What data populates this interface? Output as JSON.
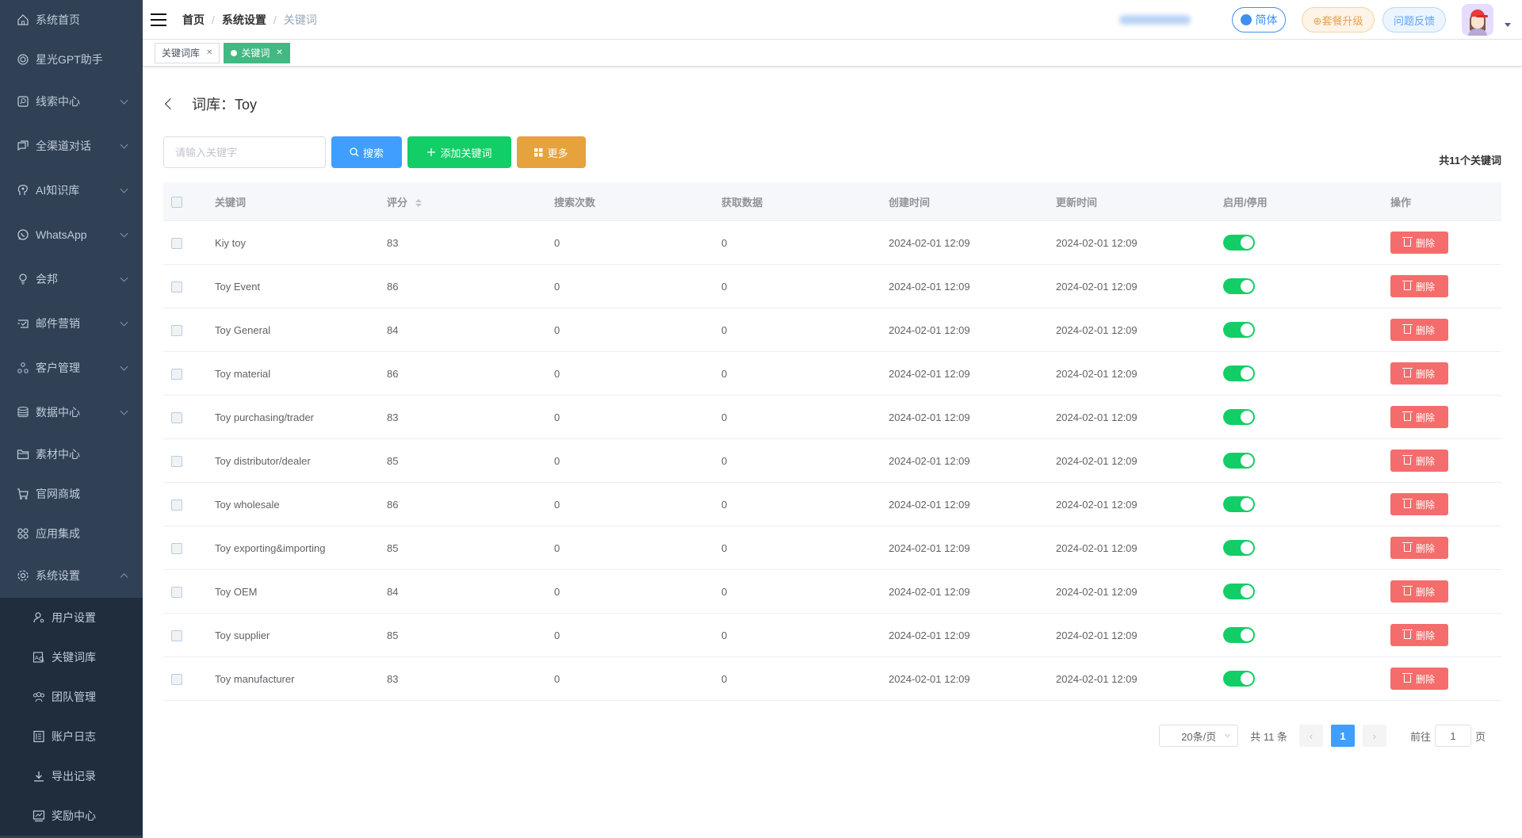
{
  "sidebar": {
    "items": [
      {
        "label": "系统首页",
        "icon": "home-icon",
        "expandable": false
      },
      {
        "label": "星光GPT助手",
        "icon": "gpt-icon",
        "expandable": false
      },
      {
        "label": "线索中心",
        "icon": "clue-search-icon",
        "expandable": true
      },
      {
        "label": "全渠道对话",
        "icon": "chat-bubbles-icon",
        "expandable": true
      },
      {
        "label": "AI知识库",
        "icon": "ai-brain-icon",
        "expandable": true
      },
      {
        "label": "WhatsApp",
        "icon": "whatsapp-icon",
        "expandable": true
      },
      {
        "label": "会邦",
        "icon": "lightbulb-icon",
        "expandable": true
      },
      {
        "label": "邮件营销",
        "icon": "mail-marketing-icon",
        "expandable": true
      },
      {
        "label": "客户管理",
        "icon": "customers-icon",
        "expandable": true
      },
      {
        "label": "数据中心",
        "icon": "database-icon",
        "expandable": true
      },
      {
        "label": "素材中心",
        "icon": "folder-icon",
        "expandable": false
      },
      {
        "label": "官网商城",
        "icon": "cart-icon",
        "expandable": false
      },
      {
        "label": "应用集成",
        "icon": "apps-icon",
        "expandable": false
      },
      {
        "label": "系统设置",
        "icon": "gear-icon",
        "expandable": true,
        "expanded": true
      }
    ],
    "submenu": [
      {
        "label": "用户设置",
        "icon": "user-settings-icon"
      },
      {
        "label": "关键词库",
        "icon": "keyword-search-icon"
      },
      {
        "label": "团队管理",
        "icon": "team-icon"
      },
      {
        "label": "账户日志",
        "icon": "log-icon"
      },
      {
        "label": "导出记录",
        "icon": "download-icon"
      },
      {
        "label": "奖励中心",
        "icon": "reward-chart-icon"
      }
    ]
  },
  "header": {
    "breadcrumb": [
      "首页",
      "系统设置",
      "关键词"
    ],
    "language_label": "简体",
    "upgrade_label": "⊕套餐升级",
    "feedback_label": "问题反馈"
  },
  "tags": [
    {
      "label": "关键词库",
      "active": false
    },
    {
      "label": "关键词",
      "active": true
    }
  ],
  "page": {
    "title": "词库：Toy",
    "search_placeholder": "请输入关键字",
    "search_value": "",
    "search_button": "搜索",
    "add_button": "添加关键词",
    "more_button": "更多",
    "total_keywords": "共11个关键词"
  },
  "table": {
    "columns": [
      "关键词",
      "评分",
      "搜索次数",
      "获取数据",
      "创建时间",
      "更新时间",
      "启用/停用",
      "操作"
    ],
    "delete_label": "删除",
    "rows": [
      {
        "keyword": "Kiy toy",
        "score": "83",
        "searches": "0",
        "fetched": "0",
        "created": "2024-02-01 12:09",
        "updated": "2024-02-01 12:09",
        "enabled": true
      },
      {
        "keyword": "Toy Event",
        "score": "86",
        "searches": "0",
        "fetched": "0",
        "created": "2024-02-01 12:09",
        "updated": "2024-02-01 12:09",
        "enabled": true
      },
      {
        "keyword": "Toy General",
        "score": "84",
        "searches": "0",
        "fetched": "0",
        "created": "2024-02-01 12:09",
        "updated": "2024-02-01 12:09",
        "enabled": true
      },
      {
        "keyword": "Toy material",
        "score": "86",
        "searches": "0",
        "fetched": "0",
        "created": "2024-02-01 12:09",
        "updated": "2024-02-01 12:09",
        "enabled": true
      },
      {
        "keyword": "Toy purchasing/trader",
        "score": "83",
        "searches": "0",
        "fetched": "0",
        "created": "2024-02-01 12:09",
        "updated": "2024-02-01 12:09",
        "enabled": true
      },
      {
        "keyword": "Toy distributor/dealer",
        "score": "85",
        "searches": "0",
        "fetched": "0",
        "created": "2024-02-01 12:09",
        "updated": "2024-02-01 12:09",
        "enabled": true
      },
      {
        "keyword": "Toy wholesale",
        "score": "86",
        "searches": "0",
        "fetched": "0",
        "created": "2024-02-01 12:09",
        "updated": "2024-02-01 12:09",
        "enabled": true
      },
      {
        "keyword": "Toy exporting&importing",
        "score": "85",
        "searches": "0",
        "fetched": "0",
        "created": "2024-02-01 12:09",
        "updated": "2024-02-01 12:09",
        "enabled": true
      },
      {
        "keyword": "Toy OEM",
        "score": "84",
        "searches": "0",
        "fetched": "0",
        "created": "2024-02-01 12:09",
        "updated": "2024-02-01 12:09",
        "enabled": true
      },
      {
        "keyword": "Toy supplier",
        "score": "85",
        "searches": "0",
        "fetched": "0",
        "created": "2024-02-01 12:09",
        "updated": "2024-02-01 12:09",
        "enabled": true
      },
      {
        "keyword": "Toy manufacturer",
        "score": "83",
        "searches": "0",
        "fetched": "0",
        "created": "2024-02-01 12:09",
        "updated": "2024-02-01 12:09",
        "enabled": true
      }
    ]
  },
  "pagination": {
    "page_size": "20条/页",
    "total": "共 11 条",
    "current_page": "1",
    "goto_label": "前往",
    "goto_value": "1",
    "page_suffix": "页"
  },
  "colors": {
    "sidebar_bg": "#304156",
    "submenu_bg": "#1f2d3d",
    "primary": "#409eff",
    "success": "#13ce66",
    "warning": "#e6a23c",
    "danger": "#f56c6c",
    "active_tag": "#42b983"
  }
}
